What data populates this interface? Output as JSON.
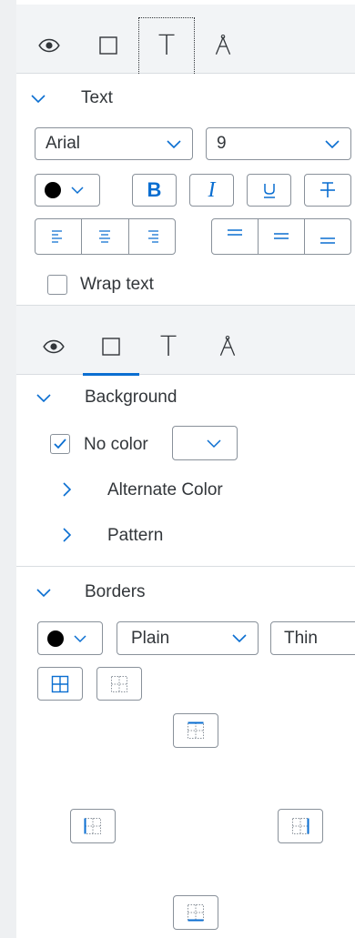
{
  "panel1": {
    "tabs": [
      {
        "icon": "eye-icon"
      },
      {
        "icon": "square-icon"
      },
      {
        "icon": "text-t-icon",
        "label": "T"
      },
      {
        "icon": "text-outline-icon"
      }
    ],
    "section_title": "Text",
    "font_family": "Arial",
    "font_size": "9",
    "bold_label": "B",
    "italic_label": "I",
    "wrap_text_label": "Wrap text",
    "wrap_text_checked": false
  },
  "panel2": {
    "tabs": [
      {
        "icon": "eye-icon"
      },
      {
        "icon": "square-icon"
      },
      {
        "icon": "text-t-icon",
        "label": "T"
      },
      {
        "icon": "text-outline-icon"
      }
    ],
    "background_title": "Background",
    "no_color_label": "No color",
    "no_color_checked": true,
    "alternate_color_label": "Alternate Color",
    "pattern_label": "Pattern",
    "borders_title": "Borders",
    "border_style": "Plain",
    "border_width": "Thin"
  },
  "colors": {
    "accent": "#0a6ed1",
    "text": "#32363a",
    "border": "#89919a",
    "tabbar_bg": "#f2f4f6"
  }
}
